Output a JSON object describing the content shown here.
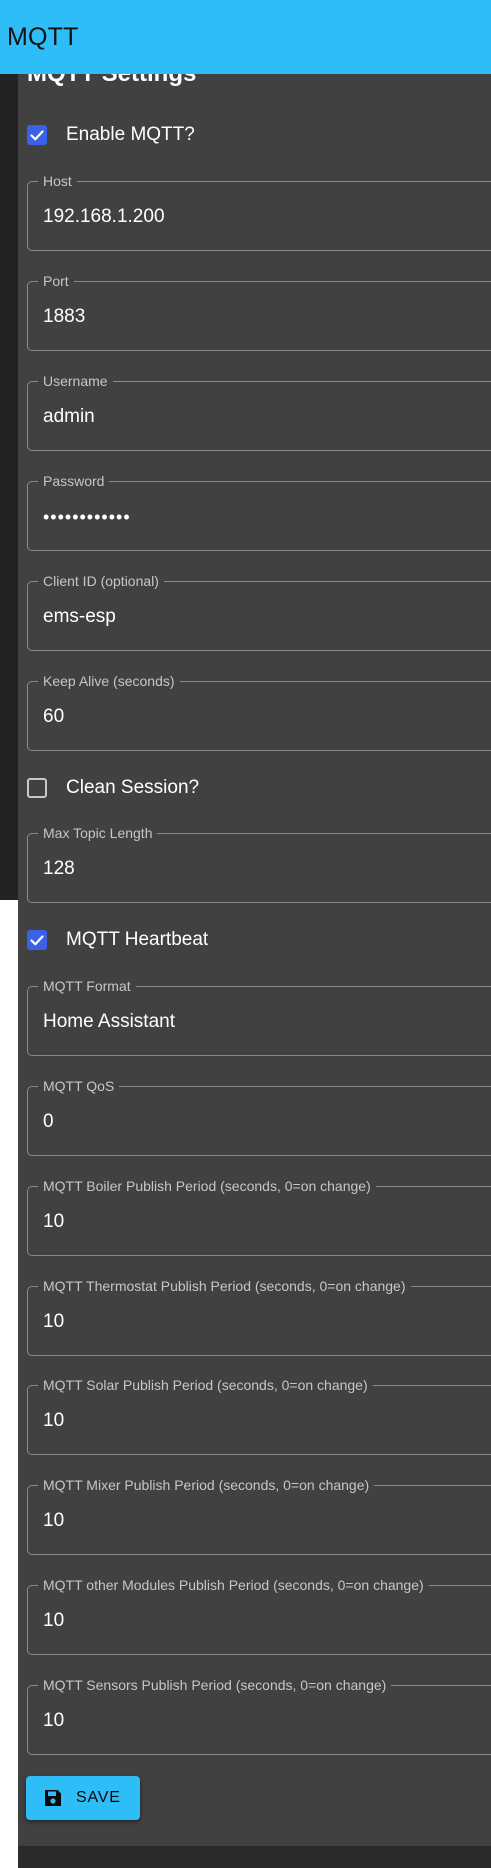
{
  "appbar": {
    "title": "MQTT"
  },
  "settings": {
    "heading": "MQTT Settings",
    "enable_mqtt": {
      "label": "Enable MQTT?",
      "checked": true
    },
    "host": {
      "label": "Host",
      "value": "192.168.1.200"
    },
    "port": {
      "label": "Port",
      "value": "1883"
    },
    "username": {
      "label": "Username",
      "value": "admin"
    },
    "password": {
      "label": "Password",
      "value": "••••••••••••"
    },
    "client_id": {
      "label": "Client ID (optional)",
      "value": "ems-esp"
    },
    "keep_alive": {
      "label": "Keep Alive (seconds)",
      "value": "60"
    },
    "clean_session": {
      "label": "Clean Session?",
      "checked": false
    },
    "max_topic_length": {
      "label": "Max Topic Length",
      "value": "128"
    },
    "heartbeat": {
      "label": "MQTT Heartbeat",
      "checked": true
    },
    "format": {
      "label": "MQTT Format",
      "value": "Home Assistant"
    },
    "qos": {
      "label": "MQTT QoS",
      "value": "0"
    },
    "boiler_period": {
      "label": "MQTT Boiler Publish Period (seconds, 0=on change)",
      "value": "10"
    },
    "thermostat_period": {
      "label": "MQTT Thermostat Publish Period (seconds, 0=on change)",
      "value": "10"
    },
    "solar_period": {
      "label": "MQTT Solar Publish Period (seconds, 0=on change)",
      "value": "10"
    },
    "mixer_period": {
      "label": "MQTT Mixer Publish Period (seconds, 0=on change)",
      "value": "10"
    },
    "other_period": {
      "label": "MQTT other Modules Publish Period (seconds, 0=on change)",
      "value": "10"
    },
    "sensors_period": {
      "label": "MQTT Sensors Publish Period (seconds, 0=on change)",
      "value": "10"
    }
  },
  "actions": {
    "save_label": "SAVE",
    "save_icon": "floppy-disk-icon"
  },
  "colors": {
    "appbar": "#2fbdf7",
    "checkbox_checked": "#3b61e6",
    "panel": "#414141",
    "save_button": "#2fbdf7"
  }
}
